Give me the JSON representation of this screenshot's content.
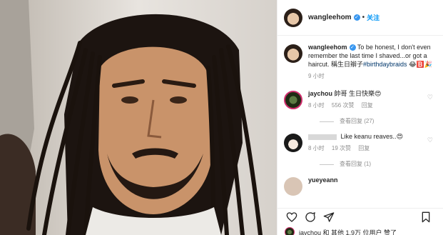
{
  "post": {
    "author": "wangleehom",
    "follow_label": "关注",
    "dot": "•",
    "photo_alt": "portrait with braids",
    "caption": {
      "text": "To be honest, I don't even remember the last time I shaved...or got a haircut. 稱生日辮子",
      "hashtag": "#birthdaybraids",
      "emoji": "😂🅱️🎉",
      "time": "9 小时"
    },
    "comments": [
      {
        "user": "jaychou",
        "text": "帥哥 生日快樂😍",
        "time": "8 小时",
        "likes": "556 次赞",
        "reply": "回复",
        "replies": "查看回复 (27)"
      },
      {
        "user": "",
        "text": "Like keanu reaves..😍",
        "time": "8 小时",
        "likes": "19 次赞",
        "reply": "回复",
        "replies": "查看回复 (1)"
      },
      {
        "user": "yueyeann"
      }
    ],
    "liked_by": "jaychou 和 其他 1.9万 位用户 赞了"
  },
  "colors": {
    "link": "#0095f6",
    "verified": "#3897f0",
    "muted": "#8e8e8e"
  },
  "icons": [
    "heart-icon",
    "comment-icon",
    "share-icon",
    "bookmark-icon",
    "verified-icon"
  ]
}
